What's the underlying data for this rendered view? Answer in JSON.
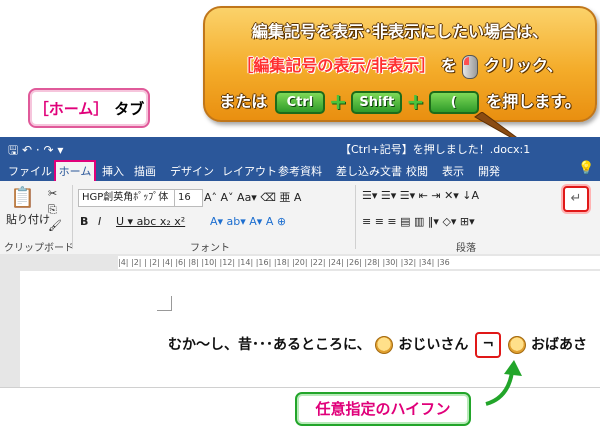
{
  "home_tab_label": {
    "bracket_open": "［",
    "text": "ホーム",
    "bracket_close": "］",
    "suffix": "タブ"
  },
  "callout": {
    "line1": "編集記号を表示･非表示にしたい場合は、",
    "line2_highlight": "［編集記号の表示/非表示］",
    "line2_after": "を",
    "line2_end": "クリック、",
    "line3_prefix": "または",
    "keys": [
      "Ctrl",
      "Shift",
      "("
    ],
    "line3_suffix": "を押します。"
  },
  "window": {
    "title": "【Ctrl+記号】を押しました！.docx:1",
    "tabs": [
      "ファイル",
      "ホーム",
      "挿入",
      "描画",
      "デザイン",
      "レイアウト",
      "参考資料",
      "差し込み文書",
      "校閲",
      "表示",
      "開発"
    ],
    "ribbon": {
      "clipboard_label": "クリップボード",
      "paste_label": "貼り付け",
      "font_name": "HGP創英角ﾎﾟｯﾌﾟ体",
      "font_size": "16",
      "font_group_label": "フォント",
      "paragraph_group_label": "段落"
    },
    "ruler_text": "|4|  |2|  |  |2|  |4|  |6|  |8|  |10|  |12|  |14|  |16|  |18|  |20|  |22|  |24|  |26|  |28|  |30|  |32|  |34|  |36"
  },
  "document": {
    "text_before": "むか～し、昔･･･あるところに、",
    "text_mid": "おじいさん",
    "hyphen_glyph": "¬",
    "text_after": "おばあさ"
  },
  "hyphen_callout": "任意指定のハイフン",
  "colors": {
    "word_blue": "#2b579a",
    "highlight_red": "#e01818",
    "pink": "#e0007a",
    "green": "#22a52a",
    "orange": "#f4ac2a"
  }
}
